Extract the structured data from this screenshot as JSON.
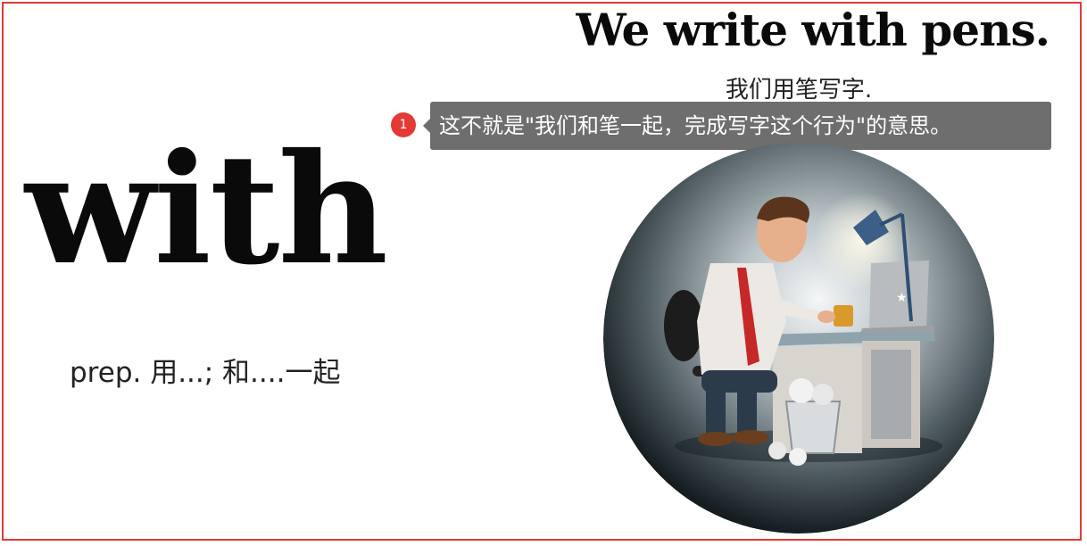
{
  "slide": {
    "word": "with",
    "definition": "prep. 用...; 和....一起",
    "example_sentence": "We write with pens.",
    "example_translation": "我们用笔写字.",
    "illustration": "man-writing-at-desk-illustration"
  },
  "annotation": {
    "number": "1",
    "text": "这不就是\"我们和笔一起，完成写字这个行为\"的意思。"
  },
  "colors": {
    "frame_border": "#e53935",
    "badge": "#e53935",
    "bubble": "#6e6e6e"
  }
}
